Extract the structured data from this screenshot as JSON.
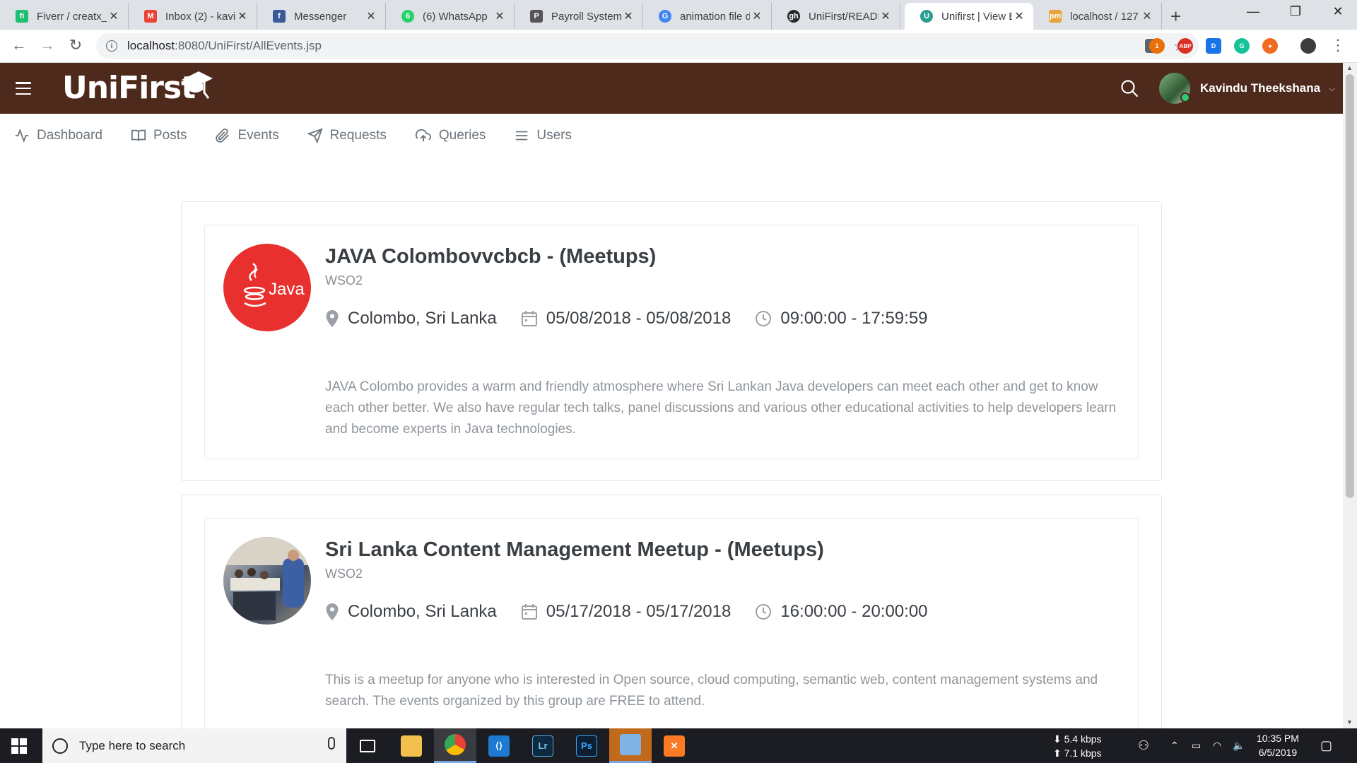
{
  "browser": {
    "tabs": [
      {
        "label": "Fiverr / creatx_d",
        "favicon_color": "#1dbf73",
        "favicon_text": "fi",
        "active": false
      },
      {
        "label": "Inbox (2) - kavi",
        "favicon_color": "#ea4335",
        "favicon_text": "M",
        "active": false
      },
      {
        "label": "Messenger",
        "favicon_color": "#3b5998",
        "favicon_text": "f",
        "active": false
      },
      {
        "label": "(6) WhatsApp",
        "favicon_color": "#25d366",
        "favicon_text": "6",
        "active": false
      },
      {
        "label": "Payroll System",
        "favicon_color": "#555555",
        "favicon_text": "P",
        "active": false
      },
      {
        "label": "animation file d",
        "favicon_color": "#4285f4",
        "favicon_text": "G",
        "active": false
      },
      {
        "label": "UniFirst/READM",
        "favicon_color": "#24292e",
        "favicon_text": "gh",
        "active": false
      },
      {
        "label": "Unifirst | View E",
        "favicon_color": "#2a9d8f",
        "favicon_text": "U",
        "active": true
      },
      {
        "label": "localhost / 127",
        "favicon_color": "#e8a33d",
        "favicon_text": "pm",
        "active": false
      }
    ],
    "new_tab": "+",
    "url_host": "localhost",
    "url_rest": ":8080/UniFirst/AllEvents.jsp",
    "extensions": [
      {
        "name": "extension-honey",
        "color": "#e8710a",
        "text": "1"
      },
      {
        "name": "extension-adblock",
        "color": "#d93025",
        "text": "ABP"
      },
      {
        "name": "extension-docs",
        "color": "#1a73e8",
        "text": "D"
      },
      {
        "name": "extension-grammarly",
        "color": "#15c39a",
        "text": "G"
      },
      {
        "name": "extension-orange",
        "color": "#f06b22",
        "text": "●"
      }
    ]
  },
  "app": {
    "logo": "UniFirst",
    "user_name": "Kavindu Theekshana",
    "nav": [
      {
        "label": "Dashboard",
        "icon": "activity-icon"
      },
      {
        "label": "Posts",
        "icon": "book-icon"
      },
      {
        "label": "Events",
        "icon": "paperclip-icon"
      },
      {
        "label": "Requests",
        "icon": "send-icon"
      },
      {
        "label": "Queries",
        "icon": "upload-cloud-icon"
      },
      {
        "label": "Users",
        "icon": "list-icon"
      }
    ]
  },
  "events": [
    {
      "title": "JAVA Colombovvcbcb - (Meetups)",
      "organizer": "WSO2",
      "location": "Colombo, Sri Lanka",
      "dates": "05/08/2018 - 05/08/2018",
      "times": "09:00:00 - 17:59:59",
      "thumb_text": "Java",
      "thumb_color": "#e8312f",
      "description": "JAVA Colombo provides a warm and friendly atmosphere where Sri Lankan Java developers can meet each other and get to know each other better. We also have regular tech talks, panel discussions and various other educational activities to help developers learn and become experts in Java technologies."
    },
    {
      "title": "Sri Lanka Content Management Meetup - (Meetups)",
      "organizer": "WSO2",
      "location": "Colombo, Sri Lanka",
      "dates": "05/17/2018 - 05/17/2018",
      "times": "16:00:00 - 20:00:00",
      "thumb_text": "",
      "thumb_color": "#6b7a8a",
      "description": "This is a meetup for anyone who is interested in Open source, cloud computing, semantic web, content management systems and search. The events organized by this group are FREE to attend."
    }
  ],
  "taskbar": {
    "search_placeholder": "Type here to search",
    "net_down": "5.4 kbps",
    "net_up": "7.1 kbps",
    "time": "10:35 PM",
    "date": "6/5/2019"
  }
}
